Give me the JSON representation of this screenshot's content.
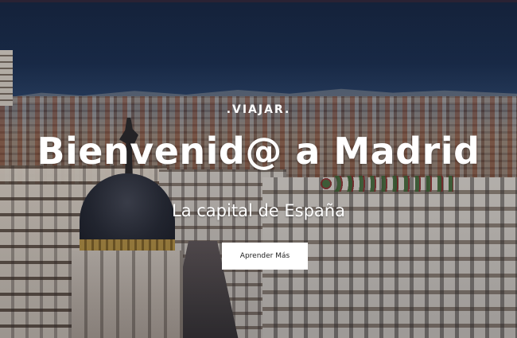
{
  "hero": {
    "kicker": ".VIAJAR.",
    "title": "Bienvenid@ a Madrid",
    "subtitle": "La capital de España",
    "cta_label": "Aprender Más"
  }
}
